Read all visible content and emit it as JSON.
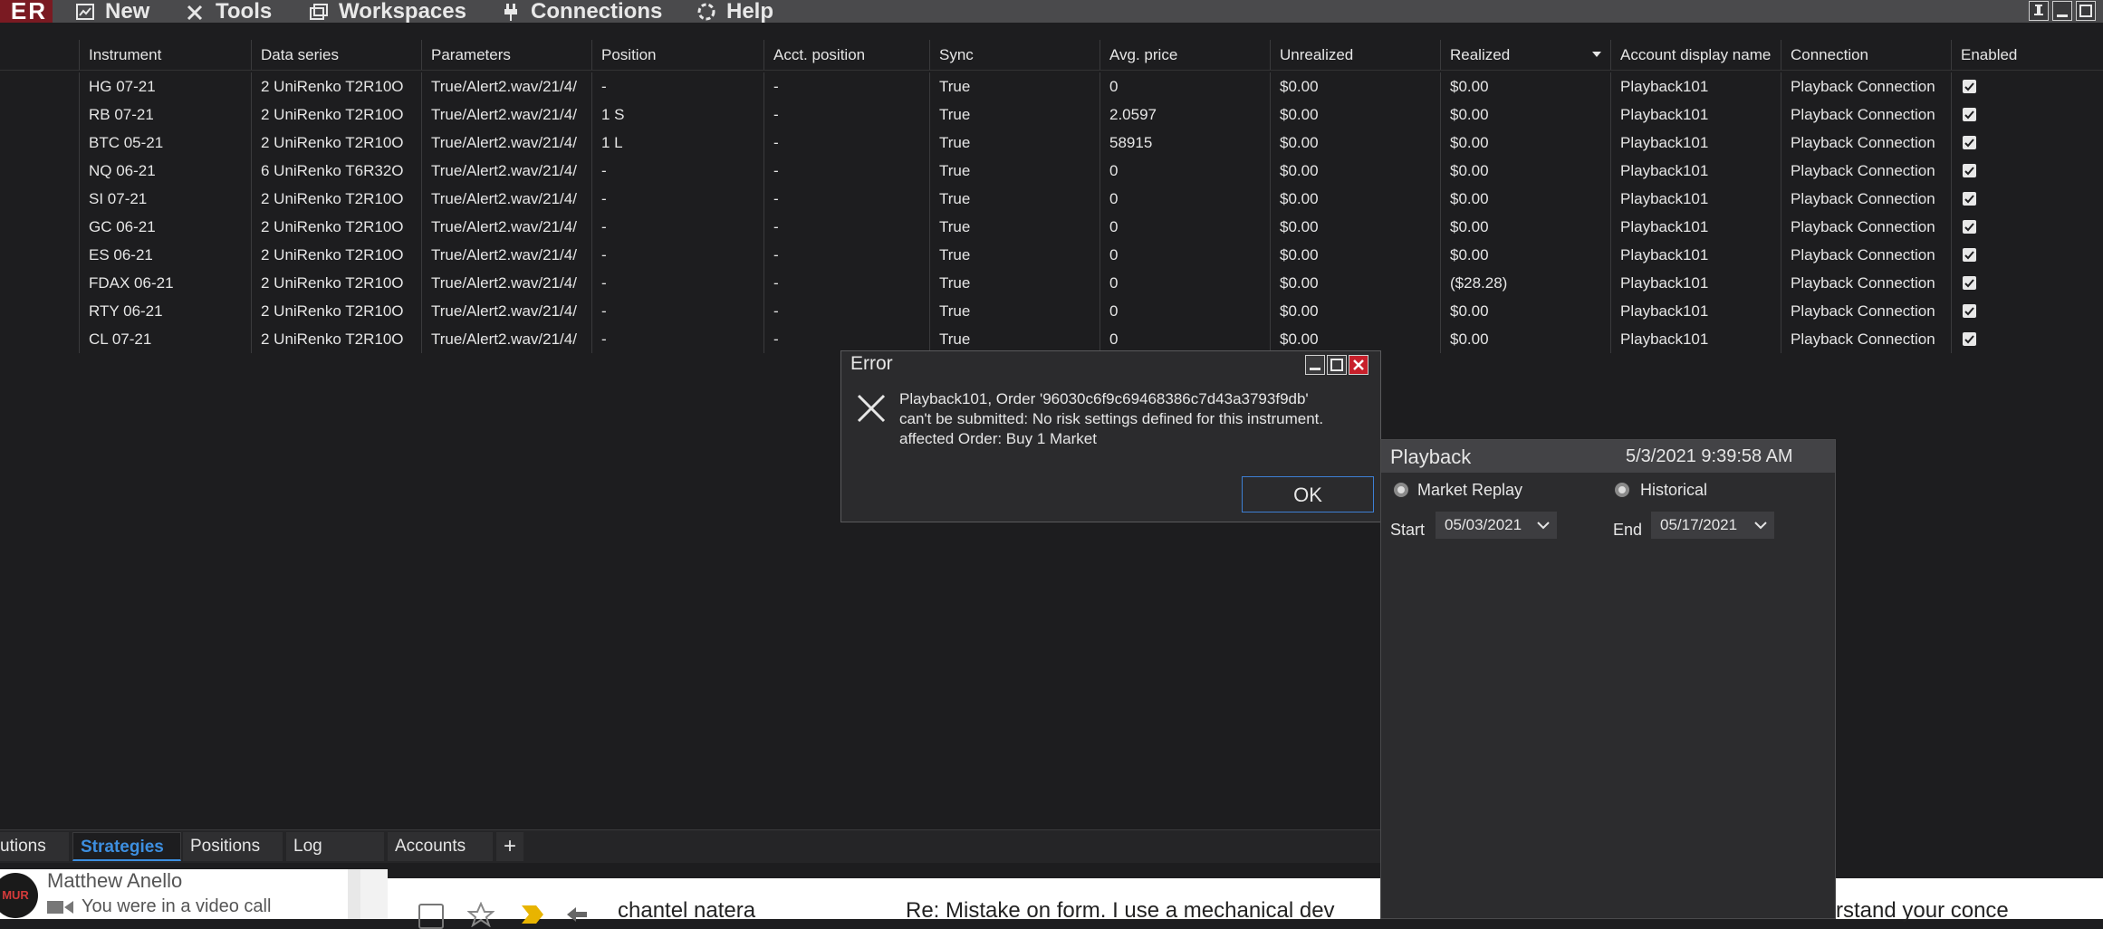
{
  "menu": {
    "logo": "ER",
    "items": [
      {
        "label": "New",
        "icon": "chart-icon"
      },
      {
        "label": "Tools",
        "icon": "tools-icon"
      },
      {
        "label": "Workspaces",
        "icon": "workspaces-icon"
      },
      {
        "label": "Connections",
        "icon": "plug-icon"
      },
      {
        "label": "Help",
        "icon": "help-icon"
      }
    ]
  },
  "grid": {
    "columns": [
      "Instrument",
      "Data series",
      "Parameters",
      "Position",
      "Acct. position",
      "Sync",
      "Avg. price",
      "Unrealized",
      "Realized",
      "Account display name",
      "Connection",
      "Enabled"
    ],
    "rows": [
      [
        "HG 07-21",
        "2 UniRenko T2R10O",
        "True/Alert2.wav/21/4/",
        "-",
        "-",
        "True",
        "0",
        "$0.00",
        "$0.00",
        "Playback101",
        "Playback Connection"
      ],
      [
        "RB 07-21",
        "2 UniRenko T2R10O",
        "True/Alert2.wav/21/4/",
        "1 S",
        "-",
        "True",
        "2.0597",
        "$0.00",
        "$0.00",
        "Playback101",
        "Playback Connection"
      ],
      [
        "BTC 05-21",
        "2 UniRenko T2R10O",
        "True/Alert2.wav/21/4/",
        "1 L",
        "-",
        "True",
        "58915",
        "$0.00",
        "$0.00",
        "Playback101",
        "Playback Connection"
      ],
      [
        "NQ 06-21",
        "6 UniRenko T6R32O",
        "True/Alert2.wav/21/4/",
        "-",
        "-",
        "True",
        "0",
        "$0.00",
        "$0.00",
        "Playback101",
        "Playback Connection"
      ],
      [
        "SI 07-21",
        "2 UniRenko T2R10O",
        "True/Alert2.wav/21/4/",
        "-",
        "-",
        "True",
        "0",
        "$0.00",
        "$0.00",
        "Playback101",
        "Playback Connection"
      ],
      [
        "GC 06-21",
        "2 UniRenko T2R10O",
        "True/Alert2.wav/21/4/",
        "-",
        "-",
        "True",
        "0",
        "$0.00",
        "$0.00",
        "Playback101",
        "Playback Connection"
      ],
      [
        "ES 06-21",
        "2 UniRenko T2R10O",
        "True/Alert2.wav/21/4/",
        "-",
        "-",
        "True",
        "0",
        "$0.00",
        "$0.00",
        "Playback101",
        "Playback Connection"
      ],
      [
        "FDAX 06-21",
        "2 UniRenko T2R10O",
        "True/Alert2.wav/21/4/",
        "-",
        "-",
        "True",
        "0",
        "$0.00",
        "($28.28)",
        "Playback101",
        "Playback Connection"
      ],
      [
        "RTY 06-21",
        "2 UniRenko T2R10O",
        "True/Alert2.wav/21/4/",
        "-",
        "-",
        "True",
        "0",
        "$0.00",
        "$0.00",
        "Playback101",
        "Playback Connection"
      ],
      [
        "CL 07-21",
        "2 UniRenko T2R10O",
        "True/Alert2.wav/21/4/",
        "-",
        "-",
        "True",
        "0",
        "$0.00",
        "$0.00",
        "Playback101",
        "Playback Connection"
      ]
    ]
  },
  "error_dialog": {
    "title": "Error",
    "message": "Playback101, Order '96030c6f9c69468386c7d43a3793f9db'\ncan't be submitted: No risk settings defined for this instrument.\naffected Order: Buy 1 Market",
    "ok_label": "OK"
  },
  "playback": {
    "title": "Playback",
    "datetime": "5/3/2021 9:39:58 AM",
    "mode_market_replay": "Market Replay",
    "mode_historical": "Historical",
    "start_label": "Start",
    "start_value": "05/03/2021",
    "end_label": "End",
    "end_value": "05/17/2021"
  },
  "tabs": {
    "partial": "utions",
    "strategies": "Strategies",
    "positions": "Positions",
    "log": "Log",
    "accounts": "Accounts",
    "add": "+"
  },
  "background_app": {
    "contact_name": "Matthew Anello",
    "contact_status": "You were in a video call",
    "email_sender": "chantel natera",
    "email_subject": "Re: Mistake on form. I use a mechanical dev",
    "email_right": "rstand your conce",
    "avatar_text": "MUR"
  },
  "colors": {
    "accent": "#3d8fe0",
    "logo_bg": "#7a1a22",
    "close_red": "#c8202b"
  }
}
